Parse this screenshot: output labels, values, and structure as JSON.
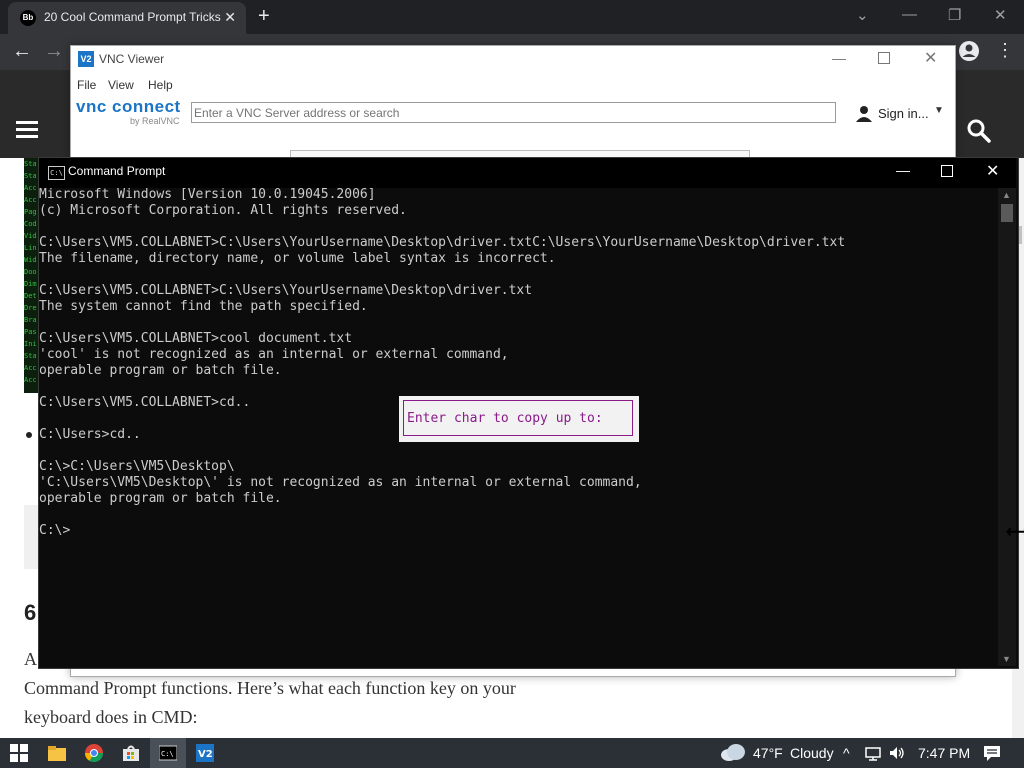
{
  "browser": {
    "tab_title": "20 Cool Command Prompt Tricks",
    "tab_close": "✕",
    "new_tab": "+",
    "favicon_text": "Bb"
  },
  "page": {
    "heading_fragment": "6",
    "paragraph_fragment": "A",
    "paragraph_line2": "Command Prompt functions. Here’s what each function key on your",
    "paragraph_line3": "keyboard does in CMD:"
  },
  "vnc": {
    "title": "VNC Viewer",
    "menu": [
      "File",
      "View",
      "Help"
    ],
    "logo_main": "vnc connect",
    "logo_sub": "by RealVNC",
    "search_placeholder": "Enter a VNC Server address or search",
    "sign_in": "Sign in..."
  },
  "cmd": {
    "title": "Command Prompt",
    "lines": [
      "Microsoft Windows [Version 10.0.19045.2006]",
      "(c) Microsoft Corporation. All rights reserved.",
      "",
      "C:\\Users\\VM5.COLLABNET>C:\\Users\\YourUsername\\Desktop\\driver.txtC:\\Users\\YourUsername\\Desktop\\driver.txt",
      "The filename, directory name, or volume label syntax is incorrect.",
      "",
      "C:\\Users\\VM5.COLLABNET>C:\\Users\\YourUsername\\Desktop\\driver.txt",
      "The system cannot find the path specified.",
      "",
      "C:\\Users\\VM5.COLLABNET>cool document.txt",
      "'cool' is not recognized as an internal or external command,",
      "operable program or batch file.",
      "",
      "C:\\Users\\VM5.COLLABNET>cd..",
      "",
      "C:\\Users>cd..",
      "",
      "C:\\>C:\\Users\\VM5\\Desktop\\",
      "'C:\\Users\\VM5\\Desktop\\' is not recognized as an internal or external command,",
      "operable program or batch file.",
      "",
      "C:\\>"
    ],
    "popup_text": "Enter char to copy up to:"
  },
  "taskbar": {
    "weather_temp": "47°F",
    "weather_desc": "Cloudy",
    "time": "7:47 PM"
  },
  "colors": {
    "vnc_blue": "#1b74c5",
    "popup_text": "#8b1a8b",
    "taskbar_bg": "#2b3036"
  }
}
